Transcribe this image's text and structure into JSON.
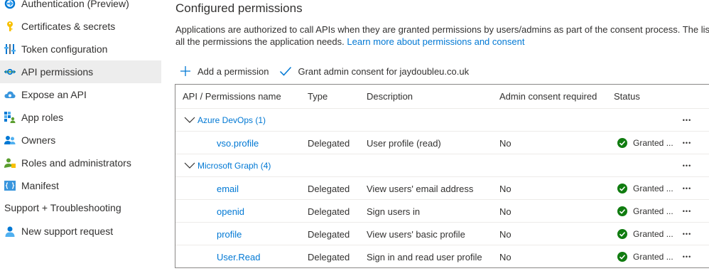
{
  "sidebar": {
    "items": [
      {
        "label": "Authentication (Preview)",
        "icon": "authentication-icon"
      },
      {
        "label": "Certificates & secrets",
        "icon": "key-icon"
      },
      {
        "label": "Token configuration",
        "icon": "token-bars-icon"
      },
      {
        "label": "API permissions",
        "icon": "api-permissions-icon"
      },
      {
        "label": "Expose an API",
        "icon": "cloud-icon"
      },
      {
        "label": "App roles",
        "icon": "app-roles-icon"
      },
      {
        "label": "Owners",
        "icon": "owners-icon"
      },
      {
        "label": "Roles and administrators",
        "icon": "roles-admin-icon"
      },
      {
        "label": "Manifest",
        "icon": "manifest-icon"
      }
    ],
    "section_label": "Support + Troubleshooting",
    "support_item": {
      "label": "New support request",
      "icon": "person-support-icon"
    },
    "active_index": 3
  },
  "main": {
    "title": "Configured permissions",
    "description_line1": "Applications are authorized to call APIs when they are granted permissions by users/admins as part of the consent process. The list",
    "description_line2_prefix": "all the permissions the application needs.",
    "learn_more_link": "Learn more about permissions and consent",
    "commands": {
      "add_permission": "Add a permission",
      "grant_consent": "Grant admin consent for jaydoubleu.co.uk"
    },
    "table": {
      "headers": [
        "API / Permissions name",
        "Type",
        "Description",
        "Admin consent required",
        "Status"
      ],
      "groups": [
        {
          "name": "Azure DevOps (1)",
          "rows": [
            {
              "name": "vso.profile",
              "type": "Delegated",
              "description": "User profile (read)",
              "admin": "No",
              "status": "Granted ..."
            }
          ]
        },
        {
          "name": "Microsoft Graph (4)",
          "rows": [
            {
              "name": "email",
              "type": "Delegated",
              "description": "View users' email address",
              "admin": "No",
              "status": "Granted ..."
            },
            {
              "name": "openid",
              "type": "Delegated",
              "description": "Sign users in",
              "admin": "No",
              "status": "Granted ..."
            },
            {
              "name": "profile",
              "type": "Delegated",
              "description": "View users' basic profile",
              "admin": "No",
              "status": "Granted ..."
            },
            {
              "name": "User.Read",
              "type": "Delegated",
              "description": "Sign in and read user profile",
              "admin": "No",
              "status": "Granted ..."
            }
          ]
        }
      ],
      "more_glyph": "•••"
    }
  },
  "colors": {
    "link": "#0078d4",
    "granted_green": "#107c10",
    "active_nav_bg": "#ededed",
    "text": "#323130"
  }
}
